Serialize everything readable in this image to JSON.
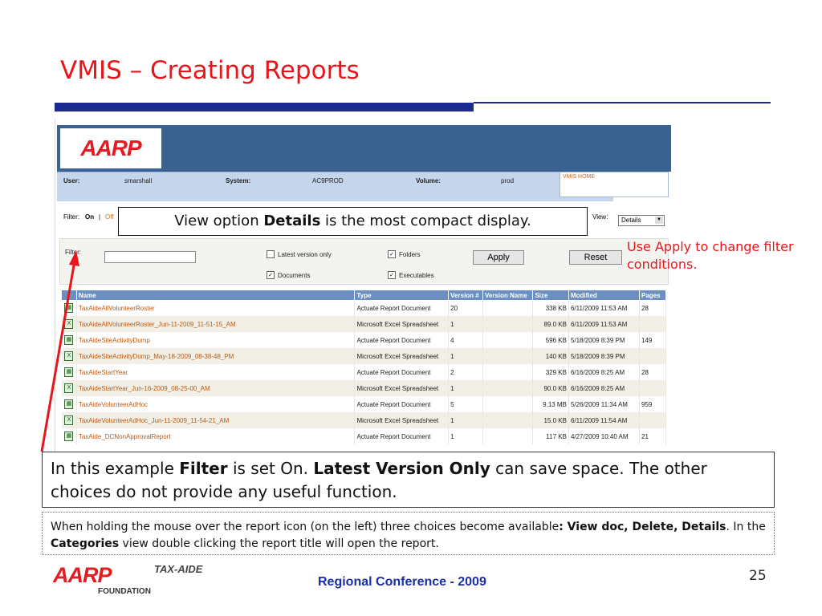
{
  "slide": {
    "title": "VMIS – Creating Reports",
    "page_number": "25",
    "footer_text": "Regional Conference - 2009",
    "footer_logo_text": "AARP",
    "footer_logo_tax": "TAX-AIDE",
    "footer_logo_foundation": "FOUNDATION"
  },
  "app": {
    "logo_text": "AARP",
    "info": {
      "user_label": "User:",
      "user_value": "smarshall",
      "system_label": "System:",
      "system_value": "AC9PROD",
      "volume_label": "Volume:",
      "volume_value": "prod"
    },
    "vmis_home": "VMIS HOME",
    "filter_toggle": {
      "label": "Filter:",
      "on": "On",
      "sep": "|",
      "off": "Off"
    },
    "view": {
      "label": "View:",
      "selected": "Details"
    },
    "filter_panel": {
      "filter_label": "Filter:",
      "filter_value": "",
      "latest_version_only": "Latest version only",
      "folders": "Folders",
      "documents": "Documents",
      "executables": "Executables",
      "apply_button": "Apply",
      "reset_button": "Reset"
    },
    "table": {
      "headers": [
        "Name",
        "Type",
        "Version #",
        "Version Name",
        "Size",
        "Modified",
        "Pages"
      ],
      "rows": [
        [
          "TaxAideAllVolunteerRoster",
          "Actuate Report Document",
          "20",
          "",
          "338 KB",
          "6/11/2009 11:53 AM",
          "28"
        ],
        [
          "TaxAideAllVolunteerRoster_Jun-11-2009_11-51-15_AM",
          "Microsoft Excel Spreadsheet",
          "1",
          "",
          "89.0 KB",
          "6/11/2009 11:53 AM",
          ""
        ],
        [
          "TaxAideSiteActivityDump",
          "Actuate Report Document",
          "4",
          "",
          "596 KB",
          "5/18/2009 8:39 PM",
          "149"
        ],
        [
          "TaxAideSiteActivityDump_May-18-2009_08-38-48_PM",
          "Microsoft Excel Spreadsheet",
          "1",
          "",
          "140 KB",
          "5/18/2009 8:39 PM",
          ""
        ],
        [
          "TaxAideStartYear",
          "Actuate Report Document",
          "2",
          "",
          "329 KB",
          "6/16/2009 8:25 AM",
          "28"
        ],
        [
          "TaxAideStartYear_Jun-16-2009_08-25-00_AM",
          "Microsoft Excel Spreadsheet",
          "1",
          "",
          "90.0 KB",
          "6/16/2009 8:25 AM",
          ""
        ],
        [
          "TaxAideVolunteerAdHoc",
          "Actuate Report Document",
          "5",
          "",
          "9.13 MB",
          "5/26/2009 11:34 AM",
          "959"
        ],
        [
          "TaxAideVolunteerAdHoc_Jun-11-2009_11-54-21_AM",
          "Microsoft Excel Spreadsheet",
          "1",
          "",
          "15.0 KB",
          "6/11/2009 11:54 AM",
          ""
        ],
        [
          "TaxAide_DCNonApprovalReport",
          "Actuate Report Document",
          "1",
          "",
          "117 KB",
          "4/27/2009 10:40 AM",
          "21"
        ]
      ]
    }
  },
  "callouts": {
    "view_pre": "View option ",
    "view_bold": "Details",
    "view_post": " is the most compact display.",
    "apply_note": "Use Apply to change filter conditions.",
    "filter_pre": "In this example ",
    "filter_bold": "Filter",
    "filter_mid": " is set On. ",
    "filter_bold2": "Latest Version Only",
    "filter_post": " can save space. The other choices do not provide any useful function.",
    "note_pre": "When holding the mouse over the report icon (on the left) three choices become available",
    "note_bold": ": View doc, Delete, Details",
    "note_mid": ". In the ",
    "note_bold2": "Categories",
    "note_post": " view double clicking the report title will open the report."
  },
  "colors": {
    "title_red": "#e8161a",
    "rule_blue": "#1c2a8f",
    "header_blue": "#3a6291",
    "table_header": "#6b8fbf",
    "footer_blue": "#1a2ea8"
  }
}
